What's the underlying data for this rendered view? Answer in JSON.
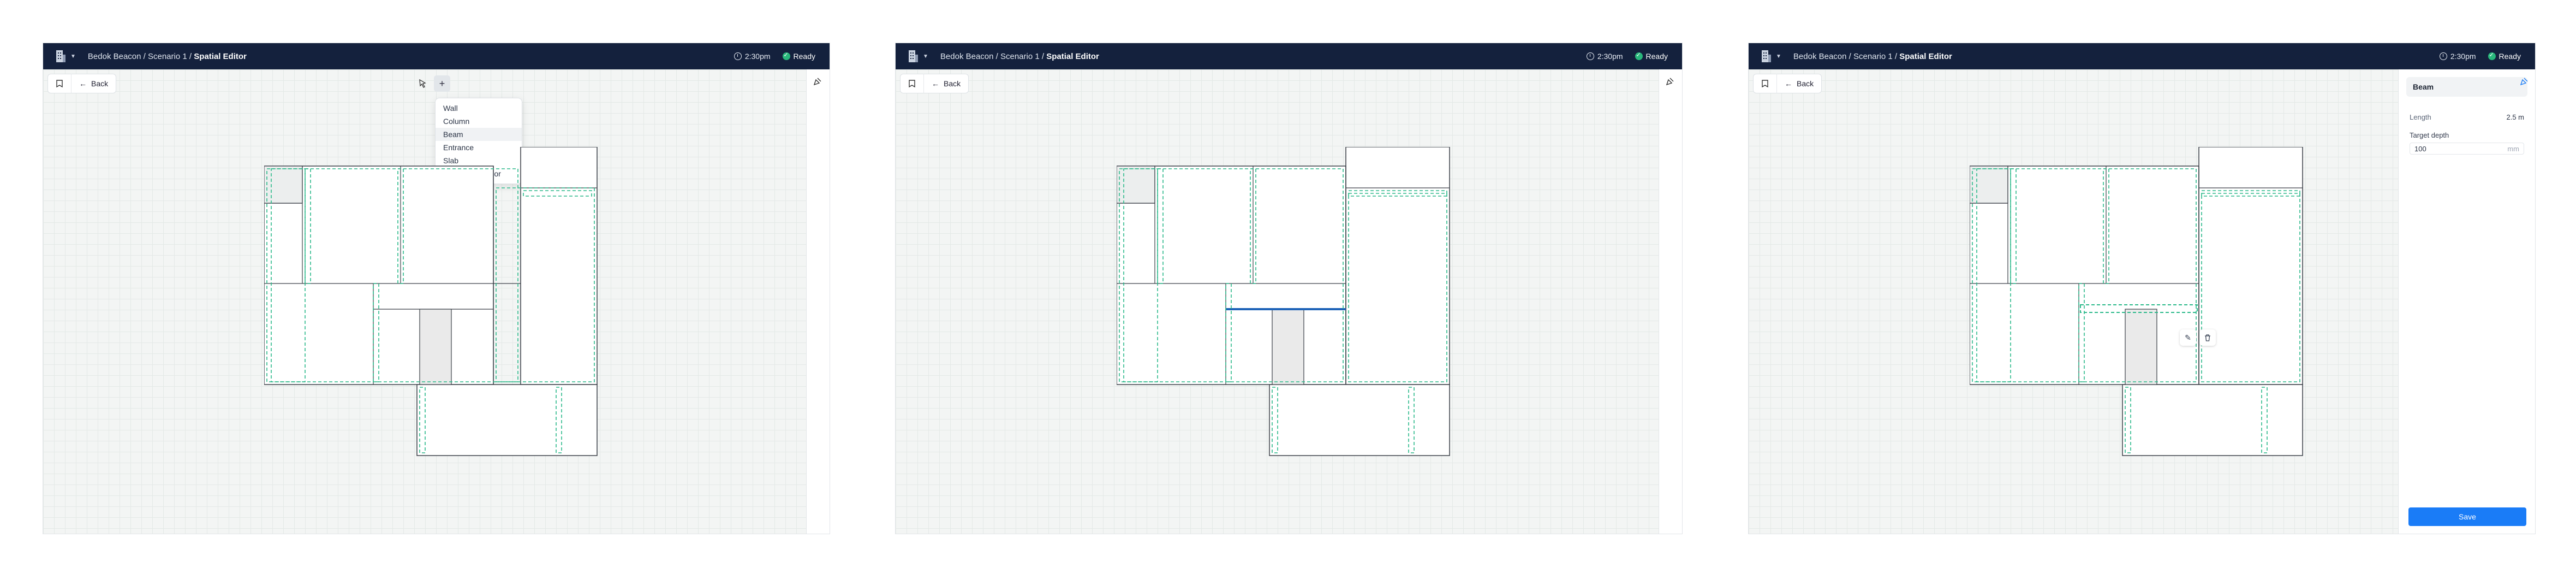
{
  "breadcrumb": {
    "path": "Bedok Beacon / Scenario 1 / ",
    "current": "Spatial Editor"
  },
  "time": "2:30pm",
  "status": "Ready",
  "back_label": "Back",
  "add_menu": {
    "items": [
      "Wall",
      "Column",
      "Beam",
      "Entrance",
      "Slab",
      "External Corridor"
    ],
    "highlighted": "Beam"
  },
  "properties_panel": {
    "title": "Beam",
    "length_label": "Length",
    "length_value": "2.5 m",
    "target_depth_label": "Target depth",
    "target_depth_value": "100",
    "target_depth_unit": "mm",
    "save_label": "Save"
  },
  "icons": [
    "building-logo-icon",
    "chevron-down-icon",
    "clock-icon",
    "check-icon",
    "bookmark-icon",
    "arrow-left-icon",
    "cursor-icon",
    "plus-icon",
    "pen-tool-icon",
    "edit-icon",
    "trash-icon"
  ],
  "colors": {
    "header": "#14213d",
    "accent": "#1a7cf7",
    "ready": "#29b77b",
    "zone_dash": "#2bb98a",
    "selected_beam": "#1f63b8"
  }
}
